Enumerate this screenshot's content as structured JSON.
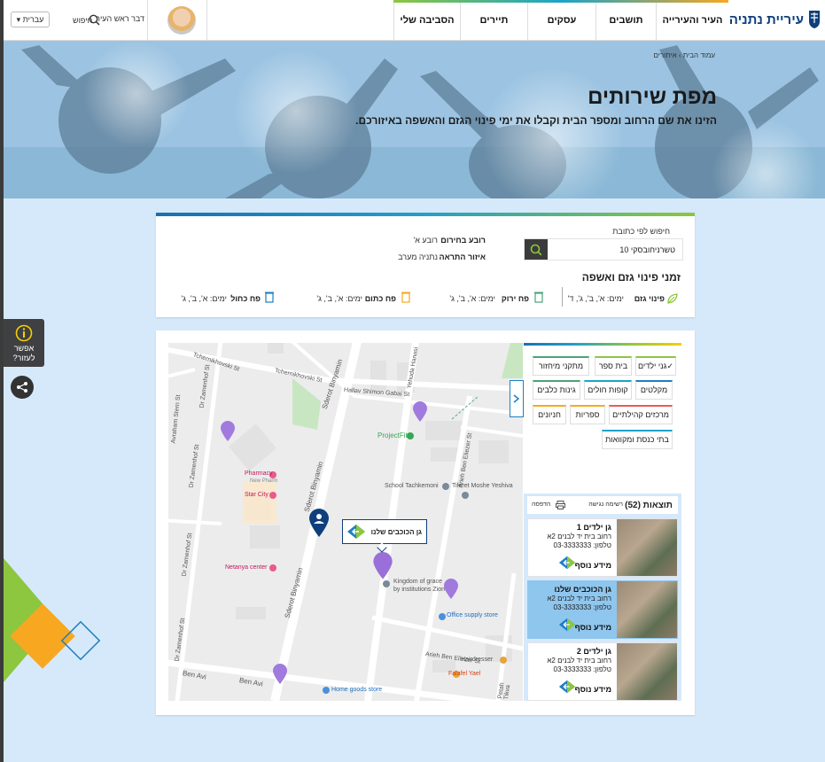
{
  "header": {
    "logo_text": "עיריית נתניה",
    "nav": [
      "העיר והעירייה",
      "תושבים",
      "עסקים",
      "תיירים",
      "הסביבה שלי"
    ],
    "user_label": "דבר ראש העיר",
    "search_label": "חיפוש",
    "language": "עברית"
  },
  "hero": {
    "breadcrumb": "עמוד הבית › איתורים",
    "title": "מפת שירותים",
    "subtitle": "הזינו את שם הרחוב ומספר הבית וקבלו את ימי פינוי הגזם והאשפה באיזורכם."
  },
  "help": {
    "line1": "אפשר",
    "line2": "לעזור?"
  },
  "address": {
    "search_label": "חיפוש לפי כתובת",
    "search_value": "טשרניחובסקי 10",
    "neighborhood_label": "רובע בחירום",
    "neighborhood_value": "רובע א'",
    "alert_label": "איזור התראה",
    "alert_value": "נתניה מערב",
    "section_title": "זמני פינוי גזם ואשפה",
    "collections": [
      {
        "name": "פינוי גזם",
        "days": "ימים: א', ב', ג', ד'",
        "color": "#8dc63f"
      },
      {
        "name": "פח ירוק",
        "days": "ימים: א', ב', ג'",
        "color": "#4aa37a"
      },
      {
        "name": "פח כתום",
        "days": "ימים: א', ב', ג'",
        "color": "#f7a820"
      },
      {
        "name": "פח כחול",
        "days": "ימים: א', ב', ג'",
        "color": "#1e7fc2"
      }
    ]
  },
  "filters": {
    "chips": [
      {
        "label": "גני ילדים",
        "checked": true,
        "color": "#8dc63f"
      },
      {
        "label": "בית ספר",
        "color": "#8dc63f"
      },
      {
        "label": "מתקני מיחזור",
        "color": "#4aa37a"
      },
      {
        "label": "מקלטים",
        "color": "#1e7fc2"
      },
      {
        "label": "קופות חולים",
        "color": "#1ca4c8"
      },
      {
        "label": "גינות כלבים",
        "color": "#4aa37a"
      },
      {
        "label": "מרכזים קהילתיים",
        "color": "#e85b5b"
      },
      {
        "label": "ספריות",
        "color": "#f7a820"
      },
      {
        "label": "חניונים",
        "color": "#f7a820"
      },
      {
        "label": "בתי כנסת ומקוואות",
        "color": "#1ca4c8"
      }
    ]
  },
  "results": {
    "title": "תוצאות (52)",
    "accessibility": "רשימה נגישה",
    "print": "הדפסה",
    "items": [
      {
        "name": "גן ילדים 1",
        "address": "רחוב בית יד לבנים 2א",
        "phone": "טלפון: 03-3333333",
        "more": "מידע נוסף",
        "selected": false
      },
      {
        "name": "גן הכוכבים שלנו",
        "address": "רחוב בית יד לבנים 2א",
        "phone": "טלפון: 03-3333333",
        "more": "מידע נוסף",
        "selected": true
      },
      {
        "name": "גן ילדים 2",
        "address": "רחוב בית יד לבנים 2א",
        "phone": "טלפון: 03-3333333",
        "more": "מידע נוסף",
        "selected": false
      }
    ]
  },
  "map": {
    "popup": "גן הכוכבים שלנו",
    "streets": [
      "Tchernikhovski St",
      "Tchernikhovski St",
      "Hallav Shimon Gabai St",
      "Sderot Binyamin",
      "Sderot Binyamin",
      "Sderot Binyamin",
      "Dr Zamenhof St",
      "Dr Zamenhof St",
      "Dr Zamenhof St",
      "Dr Zamenhof St",
      "Yehuda Hanasi",
      "Arieh Ben Eliezer St",
      "Arieh Ben Eliezer St",
      "Petah Tikva",
      "Ben Avi",
      "Ben Avi",
      "Avraham Stern St"
    ],
    "places": [
      "ProjectFit",
      "Pharmacy",
      "New Pharm",
      "Star City",
      "School Tachkemoni",
      "Tiferet Moshe Yeshiva",
      "Netanya center",
      "Kingdom of grace",
      "by institutions Zion",
      "Office supply store",
      "Hairdresser",
      "Falafel Yael",
      "Home goods store"
    ]
  }
}
